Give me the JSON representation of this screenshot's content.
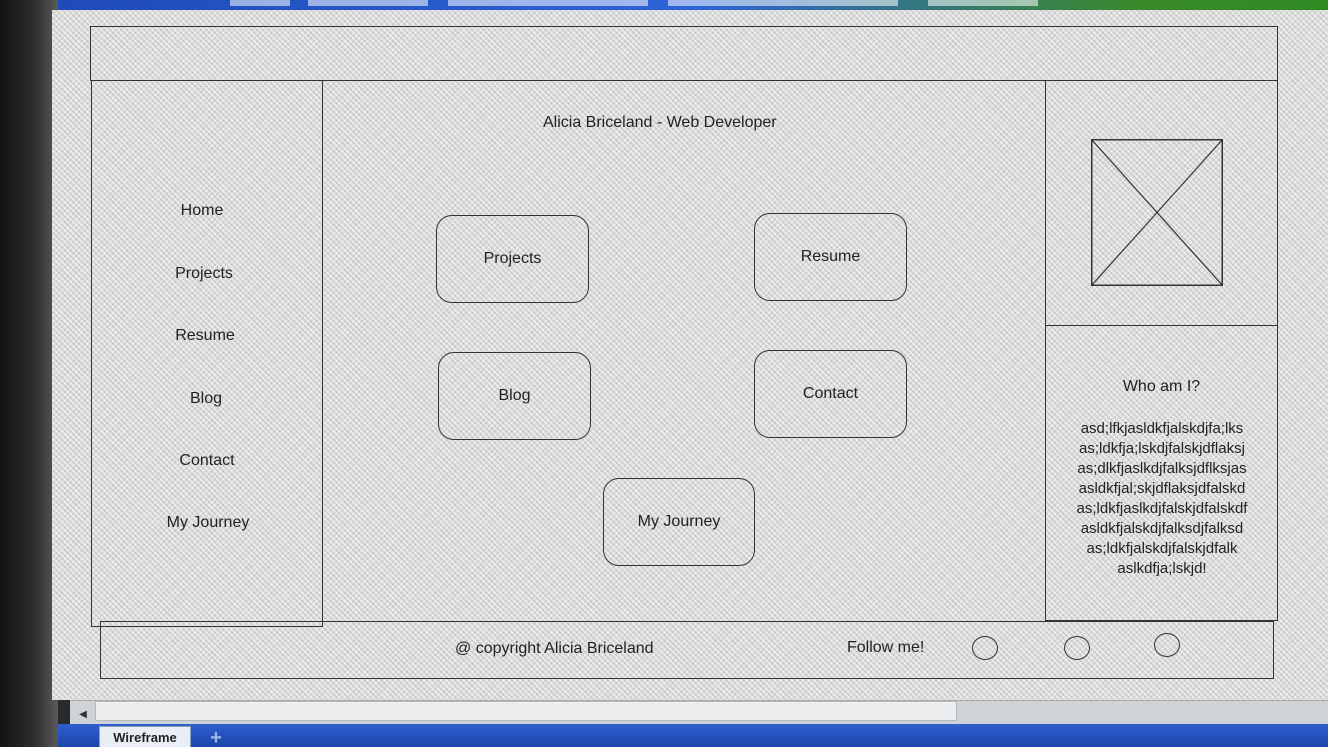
{
  "wireframe": {
    "page_title": "Alicia Briceland - Web Developer",
    "sidebar": {
      "items": [
        {
          "label": "Home"
        },
        {
          "label": "Projects"
        },
        {
          "label": "Resume"
        },
        {
          "label": "Blog"
        },
        {
          "label": "Contact"
        },
        {
          "label": "My Journey"
        }
      ]
    },
    "tiles": [
      {
        "label": "Projects"
      },
      {
        "label": "Resume"
      },
      {
        "label": "Blog"
      },
      {
        "label": "Contact"
      },
      {
        "label": "My Journey"
      }
    ],
    "about": {
      "title": "Who am I?",
      "lines": [
        "asd;lfkjasldkfjalskdjfa;lks",
        "as;ldkfja;lskdjfalskjdflaksj",
        "as;dlkfjaslkdjfalksjdflksjas",
        "asldkfjal;skjdflaksjdfalskd",
        "as;ldkfjaslkdjfalskjdfalskdf",
        "asldkfjalskdjfalksdjfalksd",
        "as;ldkfjalskdjfalskjdfalk",
        "aslkdfja;lskjd!"
      ]
    },
    "footer": {
      "copyright": "@ copyright Alicia Briceland",
      "follow_label": "Follow me!"
    }
  },
  "app": {
    "sheet_tab": "Wireframe",
    "add_tab_icon": "plus-icon",
    "scroll_left_icon": "arrow-left-icon"
  },
  "colors": {
    "toolbar_blue": "#2d63d8",
    "tabbar_blue": "#1c45a8",
    "wire_stroke": "#333333"
  }
}
